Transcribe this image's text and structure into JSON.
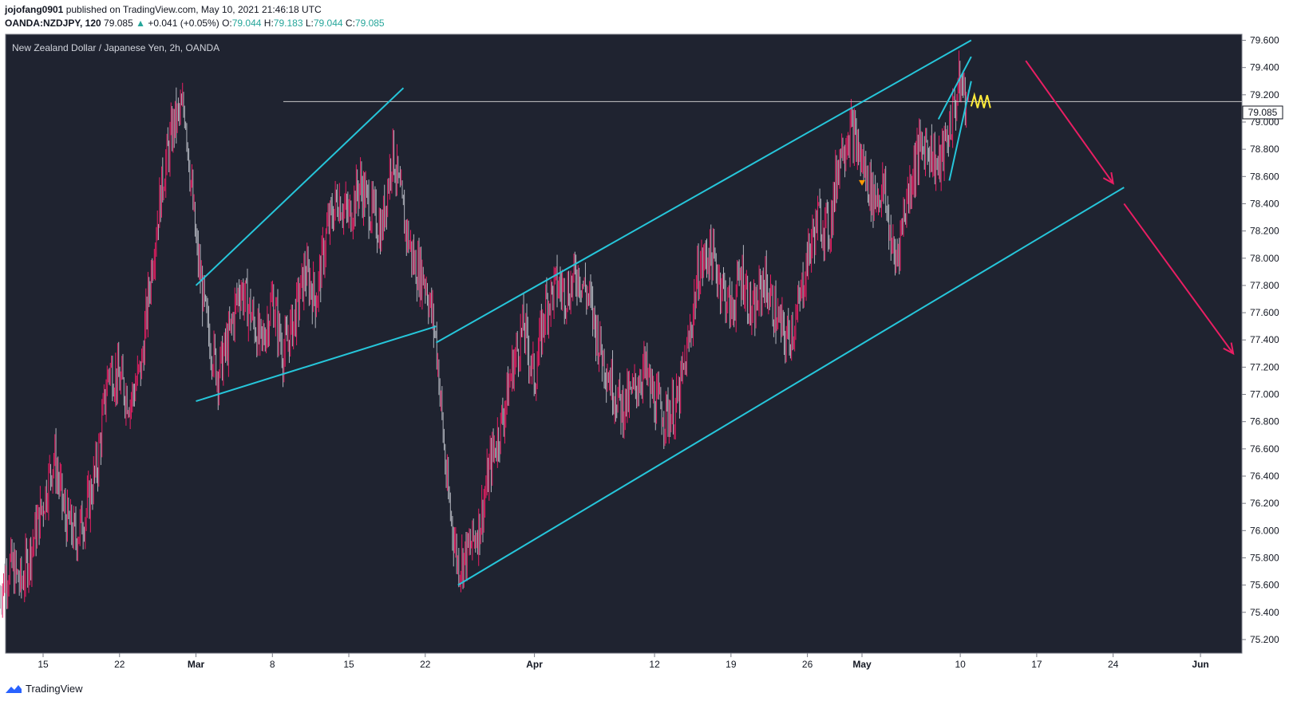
{
  "header": {
    "author": "jojofang0901",
    "published_text": "published on TradingView.com, May 10, 2021 21:46:18 UTC",
    "symbol": "OANDA:NZDJPY, 120",
    "last": "79.085",
    "change_arrow": "▲",
    "change": "+0.041 (+0.05%)",
    "o_label": "O:",
    "o_value": "79.044",
    "h_label": "H:",
    "h_value": "79.183",
    "l_label": "L:",
    "l_value": "79.044",
    "c_label": "C:",
    "c_value": "79.085"
  },
  "chart_title": "New Zealand Dollar / Japanese Yen, 2h, OANDA",
  "price_badge": "79.085",
  "footer": {
    "brand": "TradingView",
    "logo_icon": "tradingview-logo-icon"
  },
  "colors": {
    "background": "#1f2330",
    "bull": "#e91e63",
    "bear": "#b2b5be",
    "trendline": "#26c6da",
    "arrow": "#e91e63",
    "squiggle": "#ffeb3b",
    "level_line": "#c8c8c8"
  },
  "chart_data": {
    "type": "candlestick",
    "title": "New Zealand Dollar / Japanese Yen, 2h, OANDA",
    "ylim": [
      75.1,
      79.65
    ],
    "y_ticks": [
      "75.200",
      "75.400",
      "75.600",
      "75.800",
      "76.000",
      "76.200",
      "76.400",
      "76.600",
      "76.800",
      "77.000",
      "77.200",
      "77.400",
      "77.600",
      "77.800",
      "78.000",
      "78.200",
      "78.400",
      "78.600",
      "78.800",
      "79.000",
      "79.200",
      "79.400",
      "79.600"
    ],
    "x_ticks": [
      {
        "label": "15",
        "date": "2021-02-15",
        "bold": false
      },
      {
        "label": "22",
        "date": "2021-02-22",
        "bold": false
      },
      {
        "label": "Mar",
        "date": "2021-03-01",
        "bold": true
      },
      {
        "label": "8",
        "date": "2021-03-08",
        "bold": false
      },
      {
        "label": "15",
        "date": "2021-03-15",
        "bold": false
      },
      {
        "label": "22",
        "date": "2021-03-22",
        "bold": false
      },
      {
        "label": "Apr",
        "date": "2021-04-01",
        "bold": true
      },
      {
        "label": "12",
        "date": "2021-04-12",
        "bold": false
      },
      {
        "label": "19",
        "date": "2021-04-19",
        "bold": false
      },
      {
        "label": "26",
        "date": "2021-04-26",
        "bold": false
      },
      {
        "label": "May",
        "date": "2021-05-01",
        "bold": true
      },
      {
        "label": "10",
        "date": "2021-05-10",
        "bold": false
      },
      {
        "label": "17",
        "date": "2021-05-17",
        "bold": false
      },
      {
        "label": "24",
        "date": "2021-05-24",
        "bold": false
      },
      {
        "label": "Jun",
        "date": "2021-06-01",
        "bold": true
      }
    ],
    "price_path": [
      [
        "2021-02-11",
        75.55
      ],
      [
        "2021-02-12",
        75.75
      ],
      [
        "2021-02-13",
        75.6
      ],
      [
        "2021-02-15",
        76.2
      ],
      [
        "2021-02-16",
        76.55
      ],
      [
        "2021-02-17",
        76.1
      ],
      [
        "2021-02-18",
        75.95
      ],
      [
        "2021-02-19",
        76.15
      ],
      [
        "2021-02-20",
        76.5
      ],
      [
        "2021-02-21",
        77.2
      ],
      [
        "2021-02-22",
        77.1
      ],
      [
        "2021-02-23",
        76.95
      ],
      [
        "2021-02-24",
        77.2
      ],
      [
        "2021-02-25",
        78.0
      ],
      [
        "2021-02-26",
        78.6
      ],
      [
        "2021-02-27",
        79.0
      ],
      [
        "2021-02-28",
        79.1
      ],
      [
        "2021-03-01",
        78.1
      ],
      [
        "2021-03-02",
        77.5
      ],
      [
        "2021-03-03",
        77.15
      ],
      [
        "2021-03-04",
        77.4
      ],
      [
        "2021-03-05",
        77.8
      ],
      [
        "2021-03-06",
        77.6
      ],
      [
        "2021-03-07",
        77.35
      ],
      [
        "2021-03-08",
        77.7
      ],
      [
        "2021-03-09",
        77.3
      ],
      [
        "2021-03-10",
        77.55
      ],
      [
        "2021-03-11",
        77.9
      ],
      [
        "2021-03-12",
        77.7
      ],
      [
        "2021-03-13",
        78.2
      ],
      [
        "2021-03-14",
        78.45
      ],
      [
        "2021-03-15",
        78.3
      ],
      [
        "2021-03-16",
        78.55
      ],
      [
        "2021-03-17",
        78.35
      ],
      [
        "2021-03-18",
        78.2
      ],
      [
        "2021-03-19",
        78.8
      ],
      [
        "2021-03-20",
        78.3
      ],
      [
        "2021-03-21",
        77.95
      ],
      [
        "2021-03-22",
        77.85
      ],
      [
        "2021-03-23",
        77.4
      ],
      [
        "2021-03-24",
        76.3
      ],
      [
        "2021-03-25",
        75.75
      ],
      [
        "2021-03-26",
        75.85
      ],
      [
        "2021-03-27",
        76.05
      ],
      [
        "2021-03-28",
        76.5
      ],
      [
        "2021-03-29",
        76.8
      ],
      [
        "2021-03-30",
        77.2
      ],
      [
        "2021-03-31",
        77.5
      ],
      [
        "2021-04-01",
        77.1
      ],
      [
        "2021-04-02",
        77.65
      ],
      [
        "2021-04-03",
        77.8
      ],
      [
        "2021-04-04",
        77.75
      ],
      [
        "2021-04-05",
        77.9
      ],
      [
        "2021-04-06",
        77.7
      ],
      [
        "2021-04-07",
        77.35
      ],
      [
        "2021-04-08",
        77.1
      ],
      [
        "2021-04-09",
        76.9
      ],
      [
        "2021-04-10",
        77.0
      ],
      [
        "2021-04-11",
        77.2
      ],
      [
        "2021-04-12",
        76.95
      ],
      [
        "2021-04-13",
        76.85
      ],
      [
        "2021-04-14",
        76.9
      ],
      [
        "2021-04-15",
        77.3
      ],
      [
        "2021-04-16",
        77.9
      ],
      [
        "2021-04-17",
        78.05
      ],
      [
        "2021-04-18",
        77.85
      ],
      [
        "2021-04-19",
        77.6
      ],
      [
        "2021-04-20",
        77.9
      ],
      [
        "2021-04-21",
        77.55
      ],
      [
        "2021-04-22",
        77.85
      ],
      [
        "2021-04-23",
        77.6
      ],
      [
        "2021-04-24",
        77.4
      ],
      [
        "2021-04-25",
        77.55
      ],
      [
        "2021-04-26",
        78.0
      ],
      [
        "2021-04-27",
        78.3
      ],
      [
        "2021-04-28",
        78.2
      ],
      [
        "2021-04-29",
        78.8
      ],
      [
        "2021-04-30",
        78.95
      ],
      [
        "2021-05-01",
        78.7
      ],
      [
        "2021-05-02",
        78.45
      ],
      [
        "2021-05-03",
        78.5
      ],
      [
        "2021-05-04",
        77.95
      ],
      [
        "2021-05-05",
        78.4
      ],
      [
        "2021-05-06",
        78.75
      ],
      [
        "2021-05-07",
        78.85
      ],
      [
        "2021-05-08",
        78.65
      ],
      [
        "2021-05-09",
        78.95
      ],
      [
        "2021-05-10",
        79.3
      ],
      [
        "2021-05-10T20",
        79.085
      ]
    ],
    "last_price": 79.085,
    "horizontal_level": 79.15,
    "trendlines": [
      [
        [
          "2021-03-01",
          77.8
        ],
        [
          "2021-03-20",
          79.25
        ]
      ],
      [
        [
          "2021-03-01",
          76.95
        ],
        [
          "2021-03-23",
          77.5
        ]
      ],
      [
        [
          "2021-03-23",
          77.38
        ],
        [
          "2021-05-11",
          79.6
        ]
      ],
      [
        [
          "2021-03-25",
          75.6
        ],
        [
          "2021-05-25",
          78.52
        ]
      ],
      [
        [
          "2021-05-08",
          79.02
        ],
        [
          "2021-05-11",
          79.48
        ]
      ],
      [
        [
          "2021-05-09",
          78.57
        ],
        [
          "2021-05-11",
          79.3
        ]
      ]
    ],
    "arrows": [
      [
        [
          "2021-05-16",
          79.45
        ],
        [
          "2021-05-24",
          78.55
        ]
      ],
      [
        [
          "2021-05-25",
          78.4
        ],
        [
          "2021-06-04",
          77.3
        ]
      ]
    ]
  }
}
